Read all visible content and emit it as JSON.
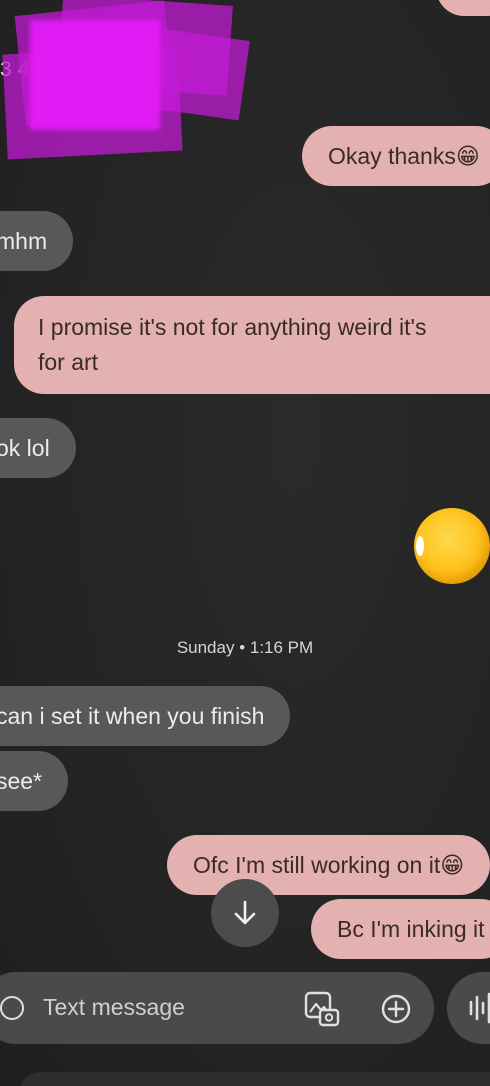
{
  "redacted_contact": {
    "label": "3 4"
  },
  "messages": [
    {
      "id": "m1",
      "side": "out",
      "text": "Okay thanks😁"
    },
    {
      "id": "m2",
      "side": "in",
      "text": "mhm"
    },
    {
      "id": "m3",
      "side": "out",
      "line1": "I promise it's not for anything weird it's",
      "line2": "for art"
    },
    {
      "id": "m4",
      "side": "in",
      "text": "ok lol"
    },
    {
      "id": "m5",
      "side": "in",
      "text": "can i set it when you finish"
    },
    {
      "id": "m6",
      "side": "in",
      "text": "see*"
    },
    {
      "id": "m7",
      "side": "out",
      "text": "Ofc I'm still working on it😁"
    },
    {
      "id": "m8",
      "side": "out",
      "text": "Bc I'm inking it"
    }
  ],
  "timestamp": "Sunday • 1:16 PM",
  "composer": {
    "placeholder": "Text message",
    "icons": [
      "emoji-icon",
      "gallery-icon",
      "plus-icon",
      "voice-icon"
    ]
  },
  "colors": {
    "background": "#262626",
    "incoming_bubble": "#585858",
    "outgoing_bubble": "#e4b1b1",
    "redaction": "#e01bf3"
  }
}
